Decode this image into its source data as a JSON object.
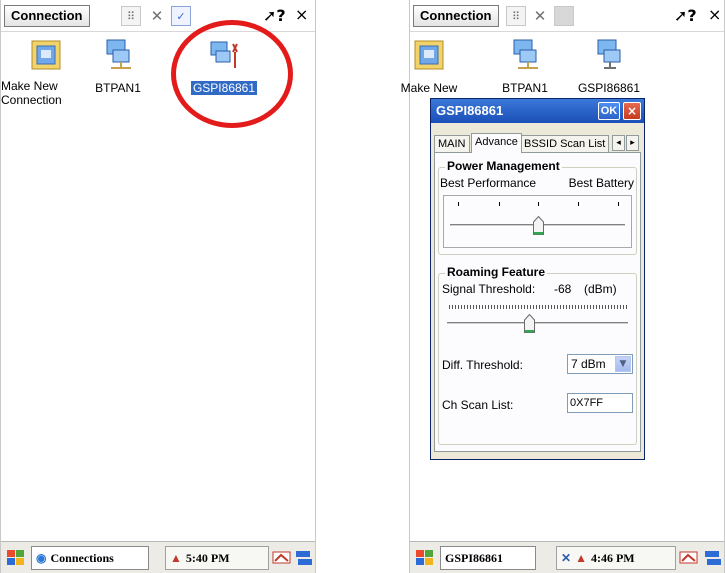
{
  "left": {
    "menu": {
      "connection_label": "Connection",
      "help_label": "?",
      "close_label": "×"
    },
    "icons": [
      {
        "label": "Make New Connection"
      },
      {
        "label": "BTPAN1"
      },
      {
        "label": "GSPI86861"
      }
    ],
    "taskbar": {
      "task_label": "Connections",
      "time": "5:40 PM"
    }
  },
  "right": {
    "menu": {
      "connection_label": "Connection",
      "help_label": "?",
      "close_label": "×"
    },
    "icons": [
      {
        "label": "Make New"
      },
      {
        "label": "BTPAN1"
      },
      {
        "label": "GSPI86861"
      }
    ],
    "dialog": {
      "title": "GSPI86861",
      "ok_label": "OK",
      "close_label": "×",
      "tabs": [
        "MAIN",
        "Advance",
        "BSSID Scan List"
      ],
      "active_tab": "Advance",
      "power_management": {
        "title": "Power Management",
        "left_label": "Best Performance",
        "right_label": "Best Battery",
        "level": 0.5
      },
      "roaming": {
        "title": "Roaming Feature",
        "signal_label": "Signal Threshold:",
        "signal_value": "-68",
        "signal_unit": "(dBm)",
        "signal_level": 0.45,
        "diff_label": "Diff. Threshold:",
        "diff_value": "7 dBm",
        "ch_label": "Ch Scan List:",
        "ch_value": "0X7FF"
      }
    },
    "taskbar": {
      "task_label": "GSPI86861",
      "time": "4:46 PM"
    }
  }
}
